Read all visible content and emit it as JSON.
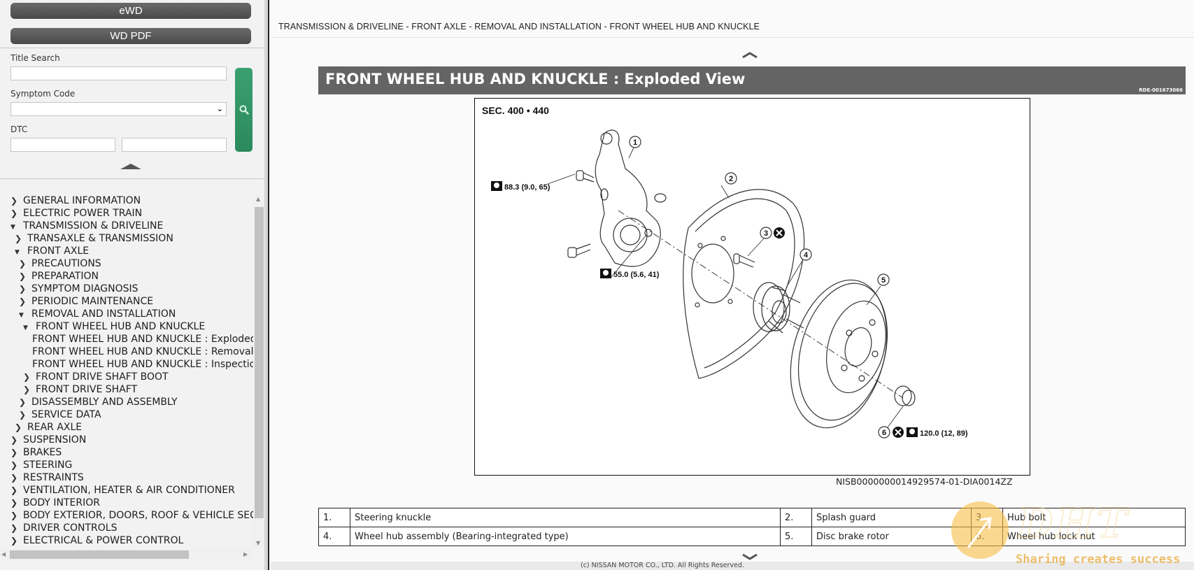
{
  "sidebar": {
    "ewd_label": "eWD",
    "wdpdf_label": "WD PDF",
    "title_search_label": "Title Search",
    "title_search_value": "",
    "symptom_code_label": "Symptom Code",
    "symptom_code_value": "",
    "dtc_label": "DTC",
    "dtc_value_1": "",
    "dtc_value_2": "",
    "search_icon": "search-icon",
    "tree": [
      {
        "label": "GENERAL INFORMATION",
        "level": 0,
        "state": "collapsed"
      },
      {
        "label": "ELECTRIC POWER TRAIN",
        "level": 0,
        "state": "collapsed"
      },
      {
        "label": "TRANSMISSION & DRIVELINE",
        "level": 0,
        "state": "expanded"
      },
      {
        "label": "TRANSAXLE & TRANSMISSION",
        "level": 1,
        "state": "collapsed"
      },
      {
        "label": "FRONT AXLE",
        "level": 1,
        "state": "expanded"
      },
      {
        "label": "PRECAUTIONS",
        "level": 2,
        "state": "collapsed"
      },
      {
        "label": "PREPARATION",
        "level": 2,
        "state": "collapsed"
      },
      {
        "label": "SYMPTOM DIAGNOSIS",
        "level": 2,
        "state": "collapsed"
      },
      {
        "label": "PERIODIC MAINTENANCE",
        "level": 2,
        "state": "collapsed"
      },
      {
        "label": "REMOVAL AND INSTALLATION",
        "level": 2,
        "state": "expanded"
      },
      {
        "label": "FRONT WHEEL HUB AND KNUCKLE",
        "level": 3,
        "state": "expanded"
      },
      {
        "label": "FRONT WHEEL HUB AND KNUCKLE : Exploded View",
        "level": 4,
        "state": "leaf"
      },
      {
        "label": "FRONT WHEEL HUB AND KNUCKLE : Removal and Installation",
        "level": 4,
        "state": "leaf"
      },
      {
        "label": "FRONT WHEEL HUB AND KNUCKLE : Inspection",
        "level": 4,
        "state": "leaf"
      },
      {
        "label": "FRONT DRIVE SHAFT BOOT",
        "level": 3,
        "state": "collapsed"
      },
      {
        "label": "FRONT DRIVE SHAFT",
        "level": 3,
        "state": "collapsed"
      },
      {
        "label": "DISASSEMBLY AND ASSEMBLY",
        "level": 2,
        "state": "collapsed"
      },
      {
        "label": "SERVICE DATA",
        "level": 2,
        "state": "collapsed"
      },
      {
        "label": "REAR AXLE",
        "level": 1,
        "state": "collapsed"
      },
      {
        "label": "SUSPENSION",
        "level": 0,
        "state": "collapsed"
      },
      {
        "label": "BRAKES",
        "level": 0,
        "state": "collapsed"
      },
      {
        "label": "STEERING",
        "level": 0,
        "state": "collapsed"
      },
      {
        "label": "RESTRAINTS",
        "level": 0,
        "state": "collapsed"
      },
      {
        "label": "VENTILATION, HEATER & AIR CONDITIONER",
        "level": 0,
        "state": "collapsed"
      },
      {
        "label": "BODY INTERIOR",
        "level": 0,
        "state": "collapsed"
      },
      {
        "label": "BODY EXTERIOR, DOORS, ROOF & VEHICLE SECURITY",
        "level": 0,
        "state": "collapsed"
      },
      {
        "label": "DRIVER CONTROLS",
        "level": 0,
        "state": "collapsed"
      },
      {
        "label": "ELECTRICAL & POWER CONTROL",
        "level": 0,
        "state": "collapsed"
      }
    ]
  },
  "main": {
    "breadcrumb": "TRANSMISSION & DRIVELINE - FRONT AXLE - REMOVAL AND INSTALLATION - FRONT WHEEL HUB AND KNUCKLE",
    "title": "FRONT WHEEL HUB AND KNUCKLE : Exploded View",
    "title_code": "RDE-001673066",
    "figure": {
      "section": "SEC. 400 • 440",
      "callouts": [
        "1",
        "2",
        "3",
        "4",
        "5",
        "6"
      ],
      "torque_1": "88.3 (9.0, 65)",
      "torque_2": "55.0 (5.6, 41)",
      "torque_3": "120.0 (12, 89)",
      "figure_id": "NISB0000000014929574-01-DIA0014ZZ"
    },
    "parts": [
      [
        {
          "num": "1.",
          "name": "Steering knuckle"
        },
        {
          "num": "2.",
          "name": "Splash guard"
        },
        {
          "num": "3.",
          "name": "Hub bolt"
        }
      ],
      [
        {
          "num": "4.",
          "name": "Wheel hub assembly (Bearing-integrated type)"
        },
        {
          "num": "5.",
          "name": "Disc brake rotor"
        },
        {
          "num": "6.",
          "name": "Wheel hub lock nut"
        }
      ]
    ],
    "copyright": "(c) NISSAN MOTOR CO., LTD. All Rights Reserved."
  },
  "watermark": {
    "logo": "DHT",
    "tagline": "Sharing creates success"
  }
}
